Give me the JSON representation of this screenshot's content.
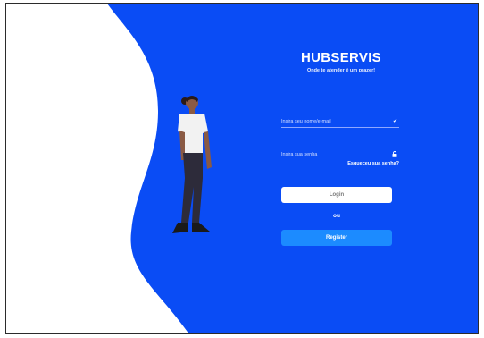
{
  "brand": {
    "title": "HUBSERVIS",
    "subtitle": "Onde te atender é um prazer!"
  },
  "login_form": {
    "email_placeholder": "Insira seu nome/e-mail",
    "email_icon": "check-icon",
    "password_placeholder": "Insira sua senha",
    "password_icon": "lock-icon",
    "forgot_password": "Esqueceu sua senha?",
    "login_button": "Login",
    "separator": "ou",
    "register_button": "Register"
  },
  "colors": {
    "background_blue": "#0a4cf5",
    "register_button": "#1c8bff",
    "login_button": "#ffffff"
  }
}
